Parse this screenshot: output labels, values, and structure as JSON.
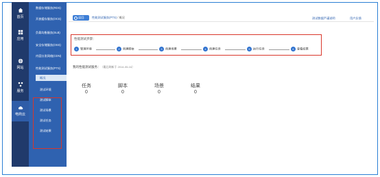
{
  "rail": {
    "items": [
      {
        "label": "首页",
        "icon": "home-icon"
      },
      {
        "label": "应用",
        "icon": "apps-icon"
      },
      {
        "label": "网站",
        "icon": "globe-icon"
      },
      {
        "label": "服务",
        "icon": "services-icon"
      }
    ],
    "cloud": {
      "label": "电商云",
      "icon": "cloud-icon"
    }
  },
  "menu": {
    "items": [
      {
        "label": "数据存储服务(RDS)"
      },
      {
        "label": "开放缓存服务(OCS)"
      },
      {
        "label": "负载均衡服务(SLB)"
      },
      {
        "label": "安全存储服务(OSS)"
      },
      {
        "label": "内容分发网络(CDN)"
      },
      {
        "label": "性能测试服务(PTS)"
      }
    ],
    "active": "概况",
    "subitems": [
      "测试环境",
      "测试脚本",
      "测试场景",
      "测试任务",
      "测试结果"
    ]
  },
  "topbar": {
    "back_label": "返回",
    "crumb_current": "性能测试服务(PTS)",
    "crumb_sep": " / ",
    "crumb_rest": "概况",
    "link1": "测试数据严谨说明",
    "link2": "用户反馈"
  },
  "steps": {
    "title": "性能测试步骤：",
    "items": [
      {
        "num": "1",
        "label": "管理环境"
      },
      {
        "num": "2",
        "label": "创建脚本"
      },
      {
        "num": "3",
        "label": "创建场景"
      },
      {
        "num": "4",
        "label": "创建任务"
      },
      {
        "num": "5",
        "label": "执行任务"
      },
      {
        "num": "6",
        "label": "查看结果"
      }
    ]
  },
  "perf": {
    "label": "我的性能测试服务：",
    "ts": "（最后刷新于 2014-05-16）"
  },
  "stats": [
    {
      "label": "任务",
      "value": "0"
    },
    {
      "label": "脚本",
      "value": "0"
    },
    {
      "label": "场景",
      "value": "0"
    },
    {
      "label": "结果",
      "value": "0"
    }
  ],
  "colors": {
    "rail": "#203a6b",
    "menu": "#2f62b0",
    "accent": "#2f72cf",
    "highlight_box": "#d9362a"
  }
}
